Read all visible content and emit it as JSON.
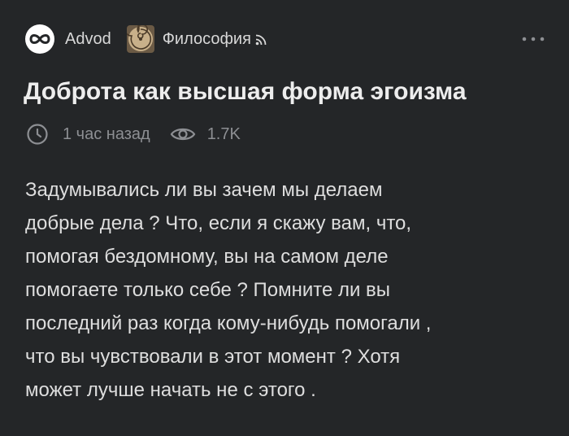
{
  "header": {
    "author_name": "Advod",
    "author_avatar_icon": "infinity-icon",
    "community_name": "Философия",
    "community_avatar_icon": "nautilus-shell-icon",
    "subscribe_icon": "rss-icon",
    "more_icon": "more-dots-icon"
  },
  "post": {
    "title": "Доброта как высшая форма эгоизма",
    "time": "1 час назад",
    "views": "1.7K",
    "body_lines": [
      "Задумывались ли вы зачем мы делаем",
      "добрые дела ? Что, если я скажу вам, что,",
      "помогая бездомному, вы на самом деле",
      "помогаете только себе ? Помните ли вы",
      "последний раз когда кому-нибудь помогали ,",
      "что вы чувствовали в этот момент ? Хотя",
      "может лучше начать не с этого ."
    ]
  },
  "colors": {
    "background": "#242628",
    "text": "#dedede",
    "muted": "#8d8f93"
  }
}
